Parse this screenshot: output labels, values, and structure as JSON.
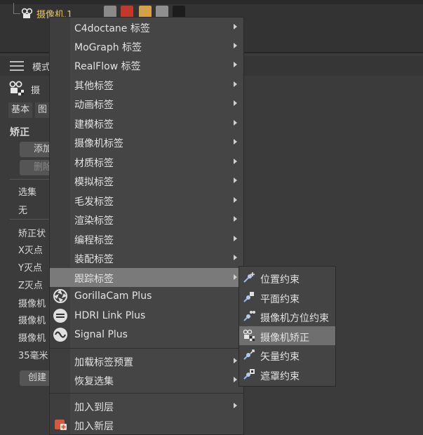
{
  "object_manager": {
    "object_name": "摄像机.1",
    "tag_colors": [
      "#8a8a8a",
      "#c0392b",
      "#d4a04a",
      "#8f8f8f",
      "#1c1c1c"
    ]
  },
  "attribute_manager": {
    "mode_label": "模式",
    "object_label": "摄",
    "tabs": [
      "基本",
      "图"
    ],
    "section_title": "矫正",
    "add_button": "添加",
    "remove_button": "删除",
    "selection_label": "选集",
    "selection_value": "无",
    "fields": [
      "矫正状",
      "X灭点",
      "Y灭点",
      "Z灭点",
      "摄像机",
      "摄像机",
      "摄像机",
      "35毫米"
    ],
    "create_button": "创建"
  },
  "context_menu": {
    "items": [
      {
        "label": "C4doctane 标签",
        "submenu": true
      },
      {
        "label": "MoGraph 标签",
        "submenu": true
      },
      {
        "label": "RealFlow 标签",
        "submenu": true
      },
      {
        "label": "其他标签",
        "submenu": true
      },
      {
        "label": "动画标签",
        "submenu": true
      },
      {
        "label": "建模标签",
        "submenu": true
      },
      {
        "label": "摄像机标签",
        "submenu": true
      },
      {
        "label": "材质标签",
        "submenu": true
      },
      {
        "label": "模拟标签",
        "submenu": true
      },
      {
        "label": "毛发标签",
        "submenu": true
      },
      {
        "label": "渲染标签",
        "submenu": true
      },
      {
        "label": "编程标签",
        "submenu": true
      },
      {
        "label": "装配标签",
        "submenu": true
      },
      {
        "label": "跟踪标签",
        "submenu": true,
        "highlighted": true
      }
    ],
    "plugins": [
      {
        "label": "GorillaCam Plus",
        "icon": "gorillacam-icon"
      },
      {
        "label": "HDRI Link Plus",
        "icon": "hdri-link-icon"
      },
      {
        "label": "Signal Plus",
        "icon": "signal-icon"
      }
    ],
    "preset_items": [
      {
        "label": "加载标签预置",
        "submenu": true
      },
      {
        "label": "恢复选集",
        "submenu": true
      }
    ],
    "layer_items": [
      {
        "label": "加入到层",
        "submenu": true
      },
      {
        "label": "加入新层",
        "submenu": false,
        "icon": "new-layer-icon"
      }
    ]
  },
  "submenu": {
    "items": [
      {
        "label": "位置约束",
        "icon": "position-constraint-icon"
      },
      {
        "label": "平面约束",
        "icon": "plane-constraint-icon"
      },
      {
        "label": "摄像机方位约束",
        "icon": "camera-orientation-icon"
      },
      {
        "label": "摄像机矫正",
        "icon": "camera-calibrator-icon",
        "highlighted": true
      },
      {
        "label": "矢量约束",
        "icon": "vector-constraint-icon"
      },
      {
        "label": "遮罩约束",
        "icon": "mask-constraint-icon"
      }
    ]
  }
}
